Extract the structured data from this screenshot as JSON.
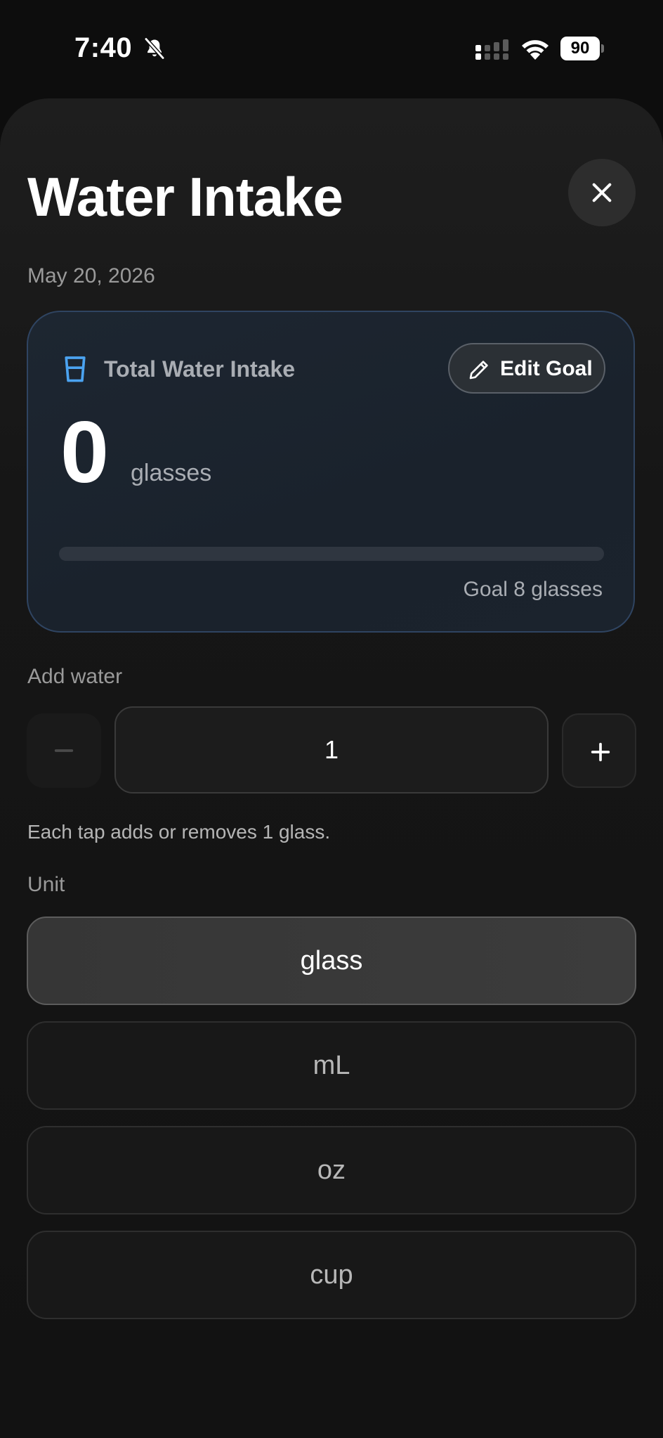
{
  "status_bar": {
    "time": "7:40",
    "battery": "90"
  },
  "header": {
    "title": "Water Intake",
    "date": "May 20, 2026"
  },
  "intake_card": {
    "label": "Total Water Intake",
    "edit_goal_label": "Edit Goal",
    "value": "0",
    "unit": "glasses",
    "goal_text": "Goal 8 glasses",
    "progress_percent": 0,
    "accent_color": "#4ba3f0",
    "border_color": "#2f4461"
  },
  "add_water": {
    "label": "Add water",
    "quantity": "1",
    "helper": "Each tap adds or removes 1 glass."
  },
  "unit_section": {
    "label": "Unit",
    "options": [
      "glass",
      "mL",
      "oz",
      "cup"
    ],
    "selected": "glass"
  },
  "icons": {
    "status": [
      "bell-slash-icon",
      "signal-icon",
      "wifi-icon",
      "battery-icon"
    ],
    "header": [
      "close-icon"
    ],
    "card": [
      "water-glass-icon",
      "pencil-icon"
    ],
    "stepper": [
      "minus-icon",
      "plus-icon"
    ]
  }
}
